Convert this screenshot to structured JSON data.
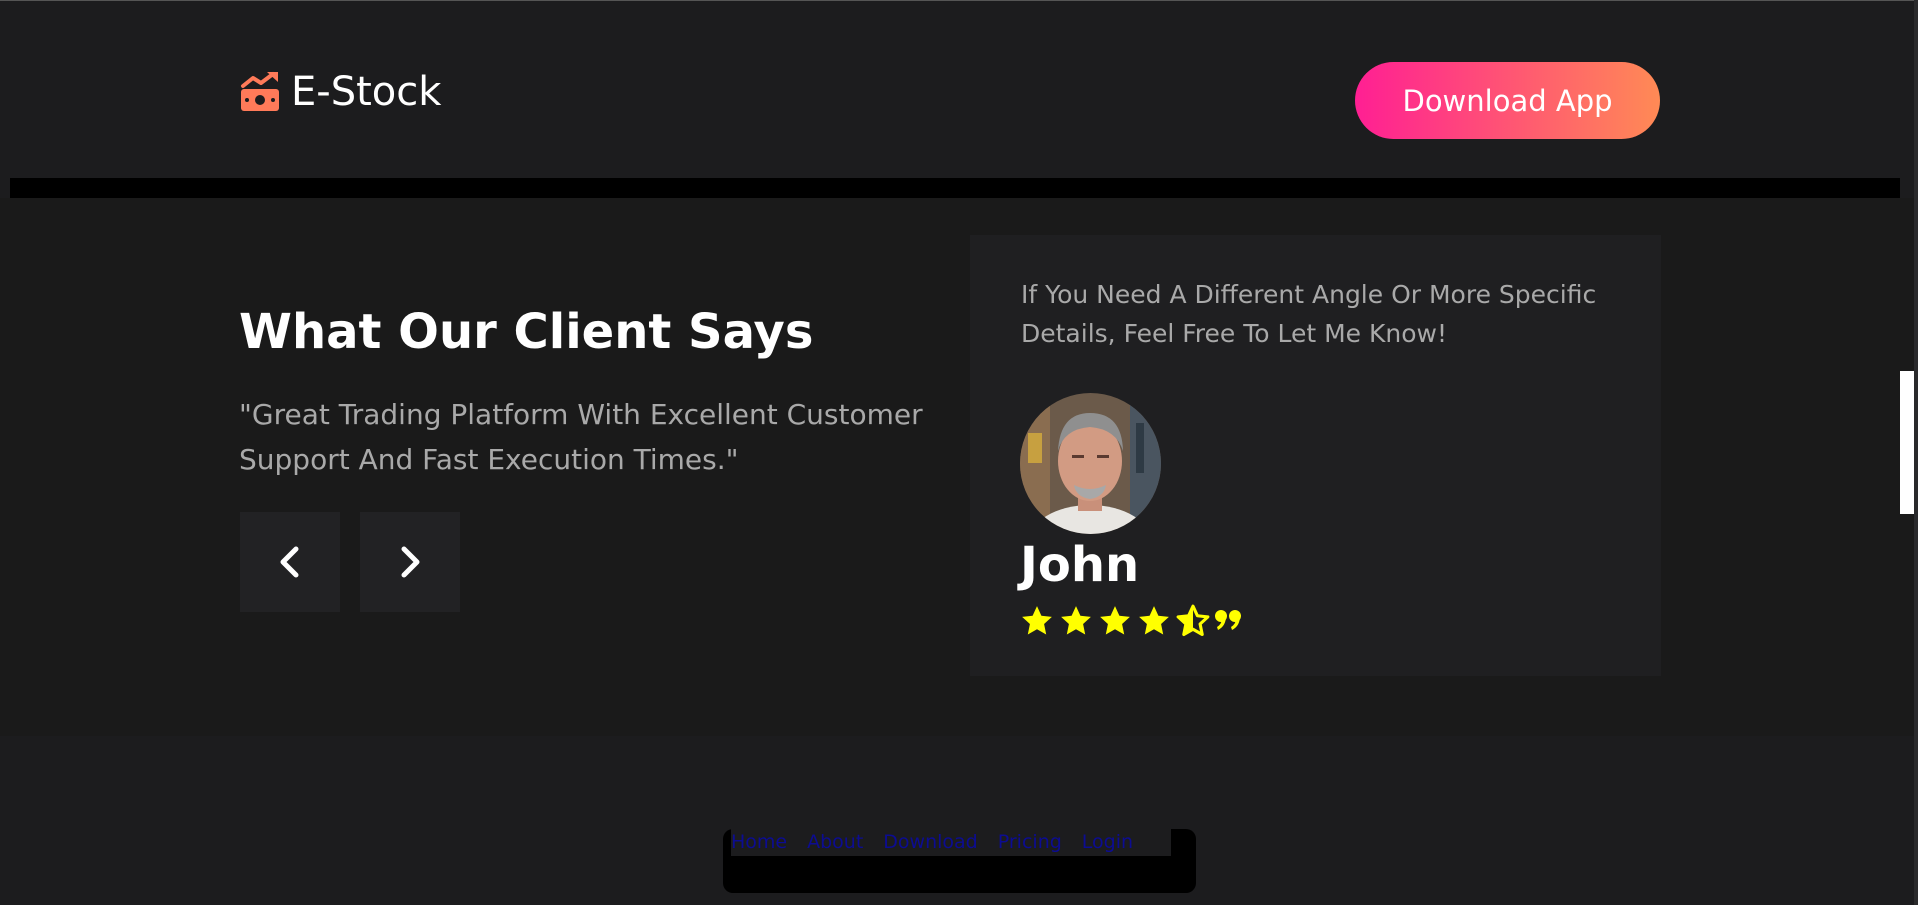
{
  "header": {
    "brand": "E-Stock",
    "logo_icon": "money-growth-icon",
    "download_label": "Download App",
    "colors": {
      "logo": "#ff7a59",
      "button_start": "#ff1f93",
      "button_end": "#ff8a55"
    }
  },
  "testimonials": {
    "heading": "What Our Client Says",
    "quote": "\"Great Trading Platform With Excellent Customer Support And Fast Execution Times.\"",
    "prev_icon": "chevron-left-icon",
    "next_icon": "chevron-right-icon",
    "card": {
      "note": "If You Need A Different Angle Or More Specific Details, Feel Free To Let Me Know!",
      "name": "John",
      "rating": 4.5,
      "rating_max": 5,
      "star_color": "#ffff00",
      "quote_icon": "quote-icon"
    }
  },
  "footer": {
    "links": [
      "Home",
      "About",
      "Download",
      "Pricing",
      "Login"
    ],
    "link_color": "#0c0c92"
  }
}
